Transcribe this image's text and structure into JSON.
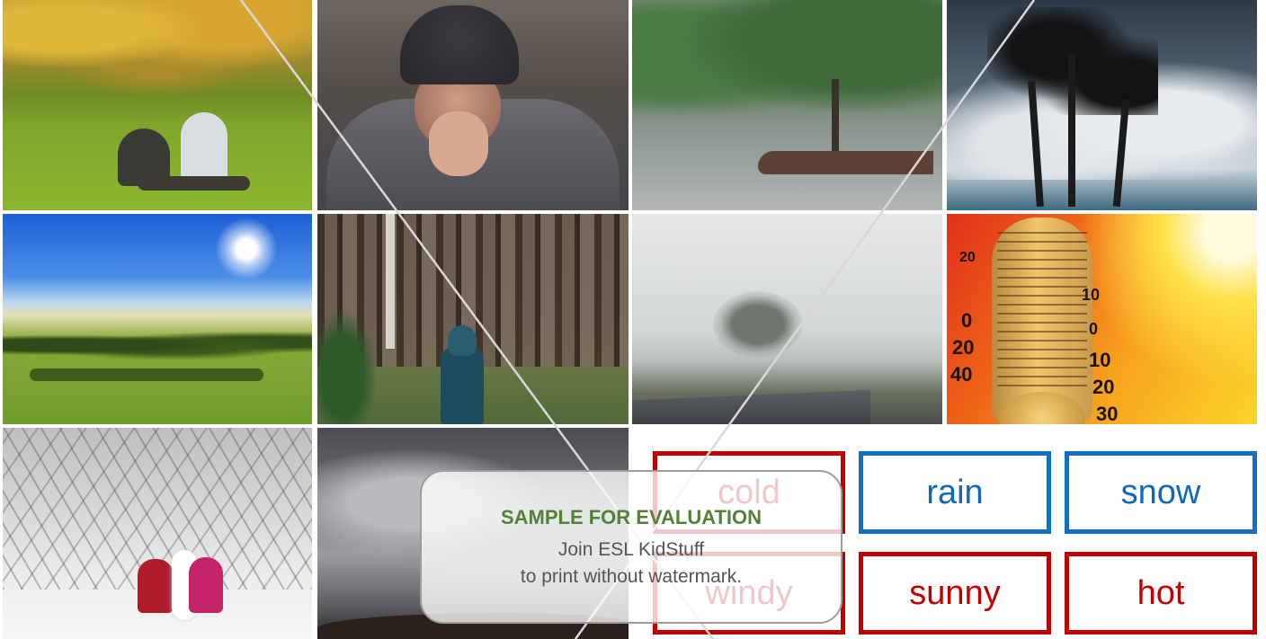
{
  "images": [
    {
      "id": "park",
      "icon": "couple-on-grass-photo"
    },
    {
      "id": "coldman",
      "icon": "cold-man-photo"
    },
    {
      "id": "rain",
      "icon": "rain-photo"
    },
    {
      "id": "windy",
      "icon": "windy-palms-photo"
    },
    {
      "id": "sunny",
      "icon": "sunny-field-photo"
    },
    {
      "id": "forest",
      "icon": "forest-photo"
    },
    {
      "id": "fog",
      "icon": "foggy-road-photo"
    },
    {
      "id": "hot",
      "icon": "thermometer-photo"
    },
    {
      "id": "snow",
      "icon": "snowman-photo"
    },
    {
      "id": "cloudy",
      "icon": "cloudy-sky-photo"
    }
  ],
  "thermometer_numbers": [
    "20",
    "0",
    "20",
    "40",
    "10",
    "0",
    "10",
    "20",
    "30"
  ],
  "word_cards": [
    {
      "label": "cold",
      "color": "#c00000"
    },
    {
      "label": "rain",
      "color": "#1170c0"
    },
    {
      "label": "snow",
      "color": "#1170c0"
    },
    {
      "label": "windy",
      "color": "#c00000"
    },
    {
      "label": "sunny",
      "color": "#c00000"
    },
    {
      "label": "hot",
      "color": "#c00000"
    }
  ],
  "watermark": {
    "title": "SAMPLE FOR EVALUATION",
    "line1": "Join ESL KidStuff",
    "line2": "to print without watermark."
  },
  "colors": {
    "card_red": "#c00000",
    "card_blue": "#1170c0",
    "watermark_title": "#538135",
    "watermark_text": "#555555"
  }
}
